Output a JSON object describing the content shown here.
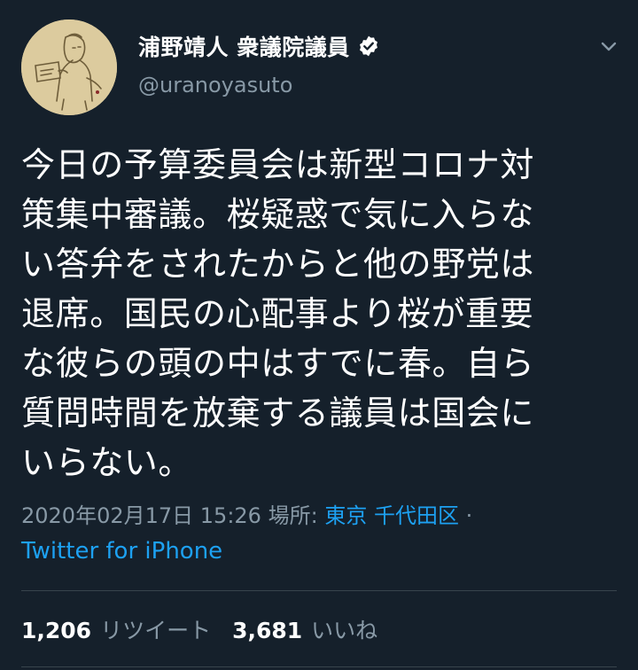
{
  "tweet": {
    "display_name": "浦野靖人 衆議院議員",
    "handle": "@uranoyasuto",
    "text": "今日の予算委員会は新型コロナ対\n策集中審議。桜疑惑で気に入らな\nい答弁をされたからと他の野党は\n退席。国民の心配事より桜が重要\nな彼らの頭の中はすでに春。自ら\n質問時間を放棄する議員は国会に\nいらない。",
    "timestamp": "2020年02月17日 15:26",
    "location_prefix": "場所:",
    "location": "東京 千代田区",
    "separator": "·",
    "source": "Twitter for iPhone",
    "retweet_count": "1,206",
    "retweet_label": "リツイート",
    "like_count": "3,681",
    "like_label": "いいね"
  },
  "icons": {
    "verified": "verified-badge-icon",
    "caret": "chevron-down-icon",
    "avatar": "profile-avatar"
  },
  "colors": {
    "background": "#15202b",
    "text": "#ffffff",
    "secondary": "#8899a6",
    "link": "#1da1f2",
    "divider": "#38444d"
  }
}
